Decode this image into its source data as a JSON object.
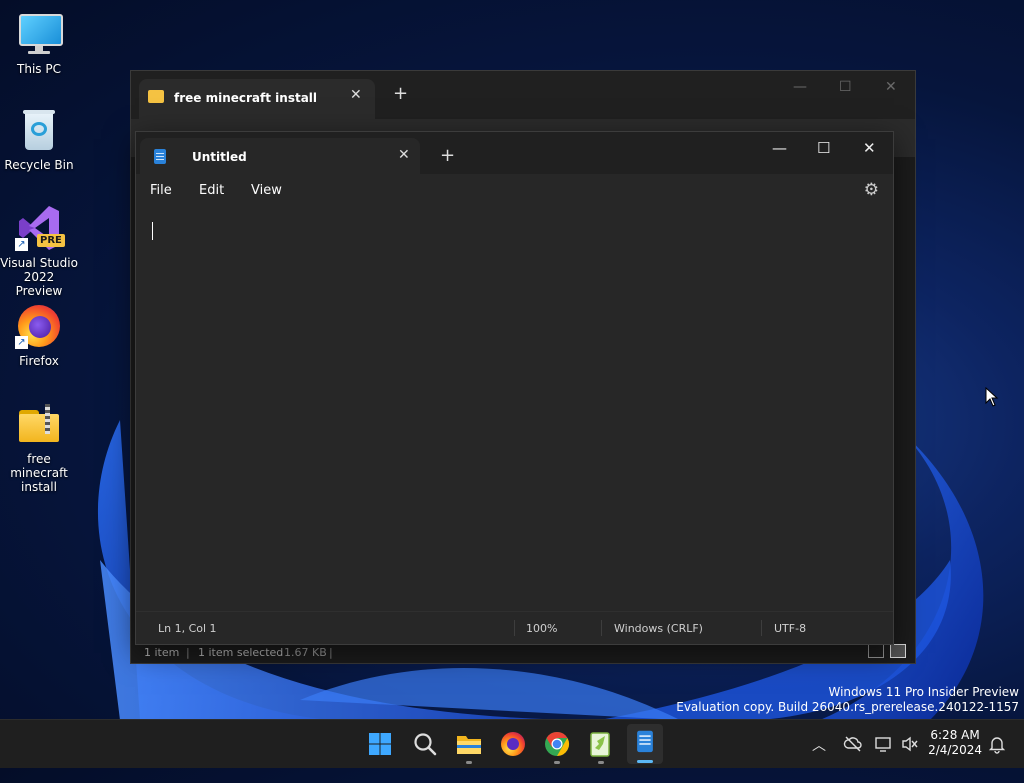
{
  "desktop": {
    "icons": [
      {
        "label": "This PC",
        "icon": "monitor-icon"
      },
      {
        "label": "Recycle Bin",
        "icon": "recycle-bin-icon"
      },
      {
        "label": "Visual Studio 2022 Preview",
        "badge": "PRE",
        "icon": "visual-studio-icon"
      },
      {
        "label": "Firefox",
        "icon": "firefox-icon"
      },
      {
        "label": "free minecraft install",
        "icon": "zip-folder-icon"
      }
    ]
  },
  "explorer": {
    "tab_title": "free minecraft install",
    "status": {
      "items": "1 item",
      "selected": "1 item selected",
      "size": "1.67 KB"
    }
  },
  "notepad": {
    "tab_title": "Untitled",
    "menu": [
      "File",
      "Edit",
      "View"
    ],
    "status": {
      "position": "Ln 1, Col 1",
      "zoom": "100%",
      "line_ending": "Windows (CRLF)",
      "encoding": "UTF-8"
    }
  },
  "watermark": {
    "line1": "Windows 11 Pro Insider Preview",
    "line2": "Evaluation copy. Build 26040.rs_prerelease.240122-1157"
  },
  "taskbar": {
    "apps": [
      "start-icon",
      "search-icon",
      "file-explorer-icon",
      "firefox-icon",
      "chrome-icon",
      "notepad-plus-plus-icon",
      "notepad-icon"
    ],
    "clock": {
      "time": "6:28 AM",
      "date": "2/4/2024"
    }
  },
  "colors": {
    "accent": "#5cb8f5",
    "folder": "#f5c242"
  }
}
